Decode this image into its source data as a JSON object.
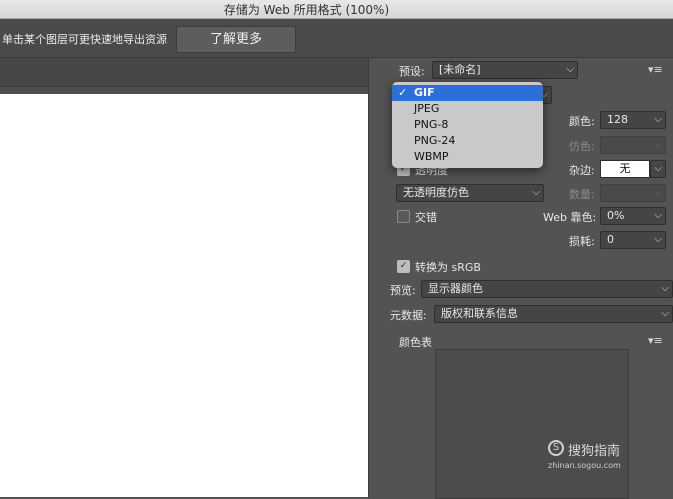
{
  "window": {
    "title": "存储为 Web 所用格式 (100%)"
  },
  "infobar": {
    "hint": "单击某个图层可更快速地导出资源",
    "learn_more": "了解更多"
  },
  "settings": {
    "preset_label": "预设:",
    "preset_value": "[未命名]",
    "colors_label": "颜色:",
    "colors_value": "128",
    "dither_label": "仿色:",
    "transparency_label": "透明度",
    "matte_label": "杂边:",
    "matte_value": "无",
    "transparency_dither_value": "无透明度仿色",
    "amount_label": "数量:",
    "interlaced_label": "交错",
    "web_snap_label": "Web 靠色:",
    "web_snap_value": "0%",
    "lossy_label": "损耗:",
    "lossy_value": "0",
    "convert_srgb_label": "转换为 sRGB",
    "preview_label": "预览:",
    "preview_value": "显示器颜色",
    "metadata_label": "元数据:",
    "metadata_value": "版权和联系信息",
    "color_table_label": "颜色表"
  },
  "format_dropdown": {
    "selected": "GIF",
    "options": [
      "GIF",
      "JPEG",
      "PNG-8",
      "PNG-24",
      "WBMP"
    ]
  },
  "watermark": {
    "text": "搜狗指南",
    "sub": "zhinan.sogou.com"
  },
  "icons": {
    "checkmark": "✓",
    "chevron": "⌵",
    "panel_menu": "⋮≡"
  }
}
